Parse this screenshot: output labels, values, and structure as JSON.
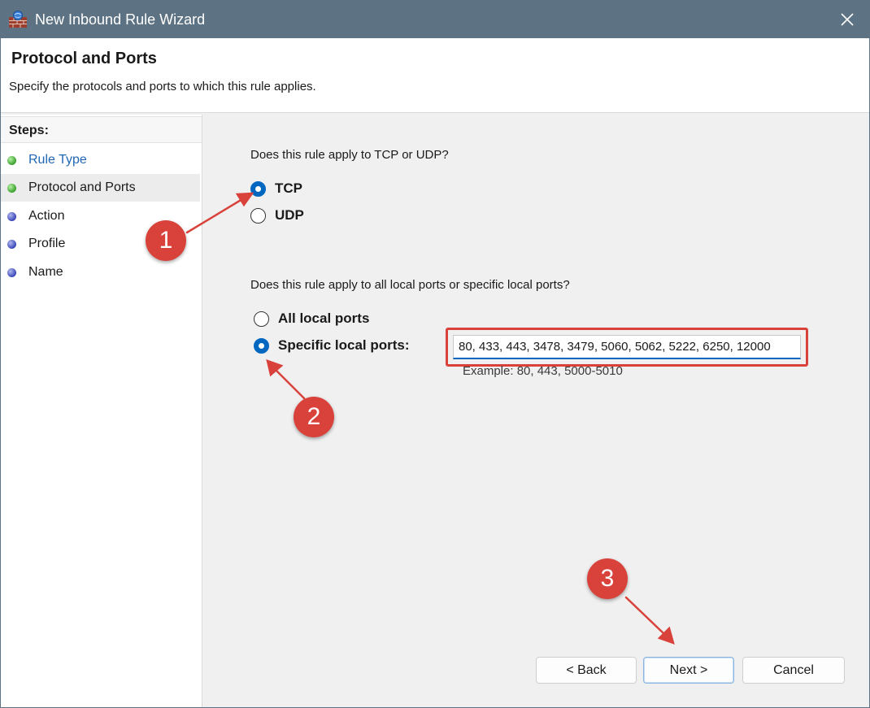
{
  "window": {
    "title": "New Inbound Rule Wizard",
    "icons": {
      "app": "firewall-icon",
      "close": "close-icon"
    }
  },
  "header": {
    "title": "Protocol and Ports",
    "subtitle": "Specify the protocols and ports to which this rule applies."
  },
  "steps": {
    "heading": "Steps:",
    "items": [
      {
        "label": "Rule Type",
        "status": "done"
      },
      {
        "label": "Protocol and Ports",
        "status": "current"
      },
      {
        "label": "Action",
        "status": "pending"
      },
      {
        "label": "Profile",
        "status": "pending"
      },
      {
        "label": "Name",
        "status": "pending"
      }
    ]
  },
  "protocol": {
    "question": "Does this rule apply to TCP or UDP?",
    "options": [
      {
        "label": "TCP",
        "checked": true
      },
      {
        "label": "UDP",
        "checked": false
      }
    ]
  },
  "ports": {
    "question": "Does this rule apply to all local ports or specific local ports?",
    "options": [
      {
        "label": "All local ports",
        "checked": false
      },
      {
        "label": "Specific local ports:",
        "checked": true
      }
    ],
    "value": "80, 433, 443, 3478, 3479, 5060, 5062, 5222, 6250, 12000",
    "example": "Example: 80, 443, 5000-5010"
  },
  "buttons": {
    "back": "< Back",
    "next": "Next >",
    "cancel": "Cancel"
  },
  "annotations": {
    "badges": [
      "1",
      "2",
      "3"
    ],
    "color": "#d9423b"
  },
  "colors": {
    "titlebar": "#5d7282",
    "accent": "#0067c0",
    "link": "#1f67b5"
  }
}
